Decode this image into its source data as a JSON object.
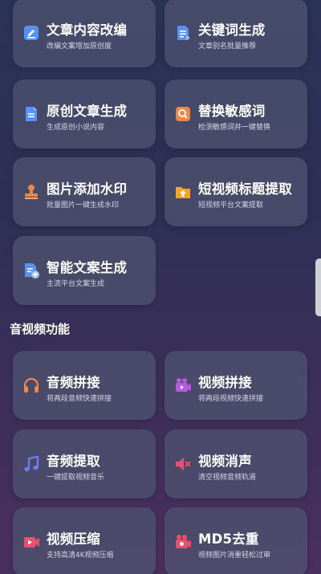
{
  "text_tools": [
    {
      "title": "文章内容改编",
      "subtitle": "改编文案增加原创度",
      "icon": "edit-document-icon",
      "color": "#5b8ff0"
    },
    {
      "title": "关键词生成",
      "subtitle": "文章别名批量推荐",
      "icon": "document-list-icon",
      "color": "#5b8ff0"
    },
    {
      "title": "原创文章生成",
      "subtitle": "生成原创小说内容",
      "icon": "document-lines-icon",
      "color": "#5b8ff0"
    },
    {
      "title": "替换敏感词",
      "subtitle": "检测敏感词并一键替换",
      "icon": "search-icon",
      "color": "#f0874a"
    },
    {
      "title": "图片添加水印",
      "subtitle": "批量图片一键生成水印",
      "icon": "stamp-icon",
      "color": "#f0874a"
    },
    {
      "title": "短视频标题提取",
      "subtitle": "短视频平台文案提取",
      "icon": "folder-upload-icon",
      "color": "#f5a623"
    },
    {
      "title": "智能文案生成",
      "subtitle": "主流平台文案生成",
      "icon": "document-add-icon",
      "color": "#5b8ff0"
    }
  ],
  "av_section": {
    "title": "音视频功能",
    "items": [
      {
        "title": "音频拼接",
        "subtitle": "将两段音频快速拼接",
        "icon": "headphones-icon",
        "color": "#f0874a"
      },
      {
        "title": "视频拼接",
        "subtitle": "将两段视频快速拼接",
        "icon": "video-camera-icon",
        "color": "#b45be0"
      },
      {
        "title": "音频提取",
        "subtitle": "一键提取视频音乐",
        "icon": "music-note-icon",
        "color": "#6f7ff0"
      },
      {
        "title": "视频消声",
        "subtitle": "清空视频音频轨道",
        "icon": "speaker-mute-icon",
        "color": "#e8506e"
      },
      {
        "title": "视频压缩",
        "subtitle": "支持高清4K视频压缩",
        "icon": "video-play-icon",
        "color": "#e8506e"
      },
      {
        "title": "MD5去重",
        "subtitle": "视频图片消重轻松过审",
        "icon": "film-camera-icon",
        "color": "#e8506e"
      }
    ]
  }
}
